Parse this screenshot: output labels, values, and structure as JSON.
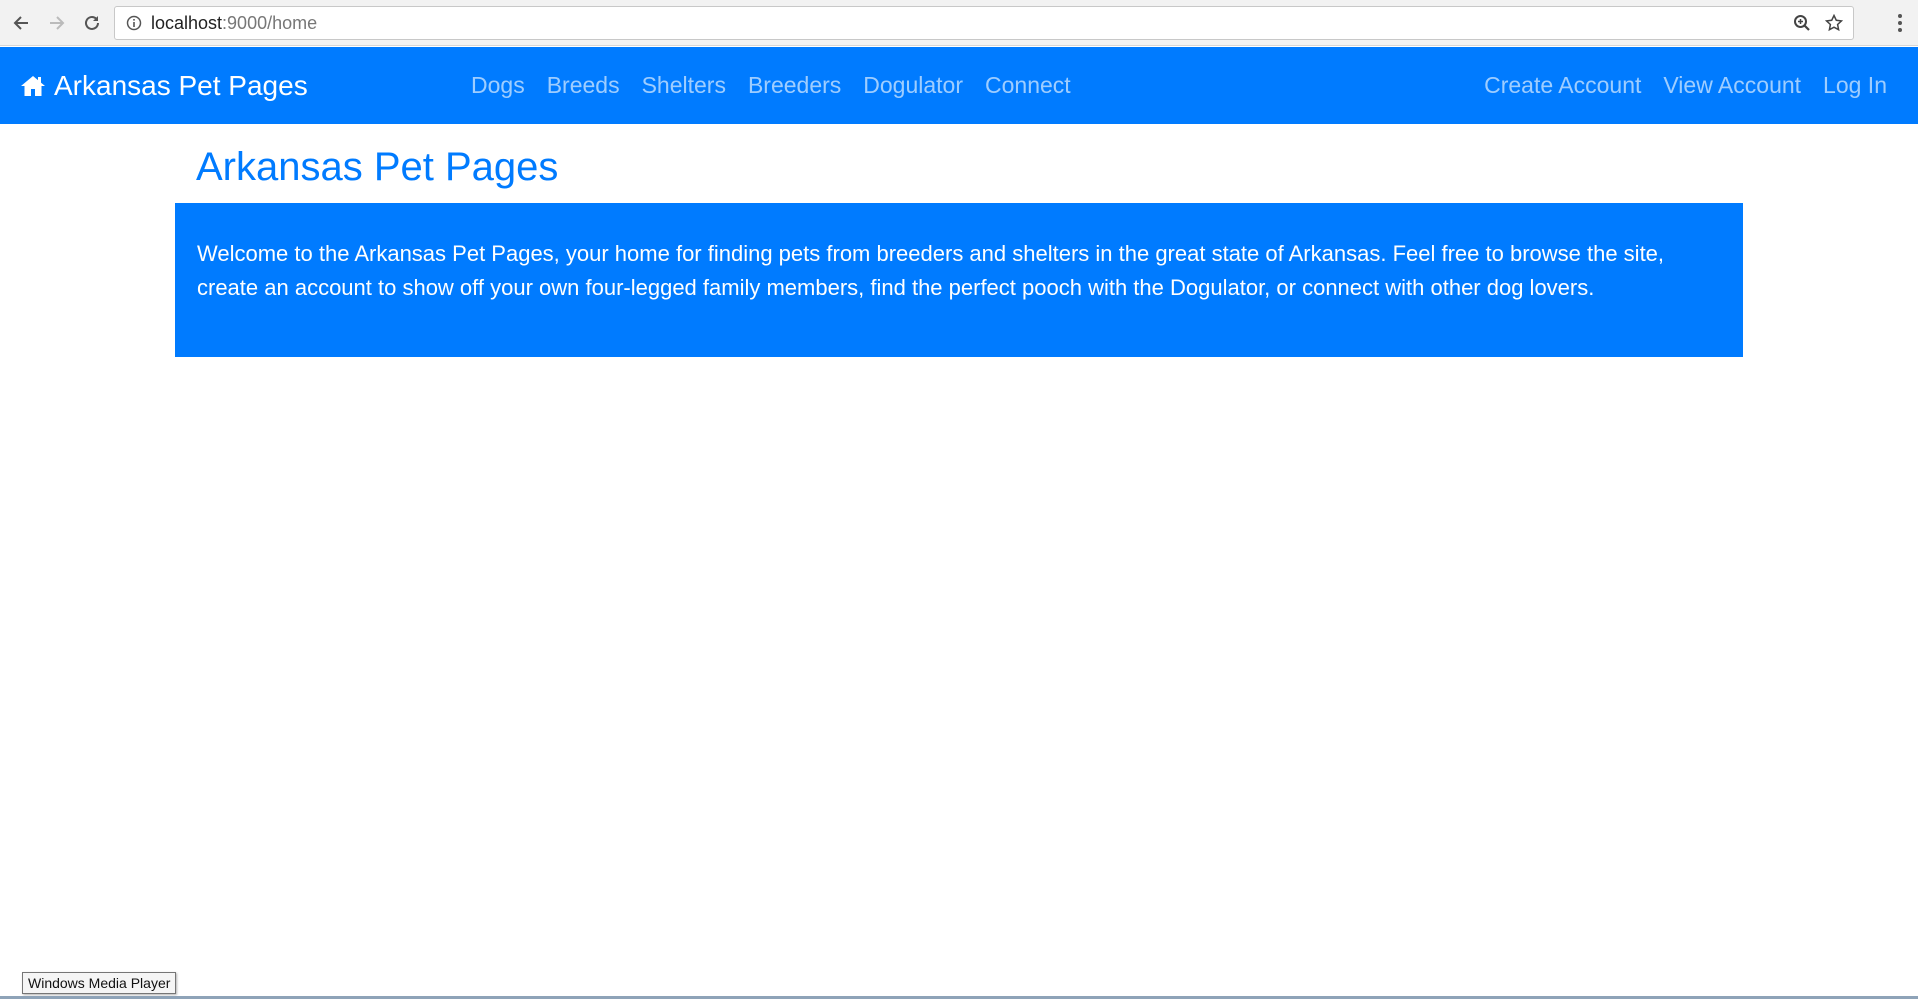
{
  "browser": {
    "url_host": "localhost",
    "url_rest": ":9000/home"
  },
  "navbar": {
    "brand": "Arkansas Pet Pages",
    "links_left": [
      "Dogs",
      "Breeds",
      "Shelters",
      "Breeders",
      "Dogulator",
      "Connect"
    ],
    "links_right": [
      "Create Account",
      "View Account",
      "Log In"
    ],
    "color": "#007bff"
  },
  "main": {
    "title": "Arkansas Pet Pages",
    "welcome_text": "Welcome to the Arkansas Pet Pages, your home for finding pets from breeders and shelters in the great state of Arkansas. Feel free to browse the site, create an account to show off your own four-legged family members, find the perfect pooch with the Dogulator, or connect with other dog lovers."
  },
  "taskbar": {
    "tooltip": "Windows Media Player"
  }
}
